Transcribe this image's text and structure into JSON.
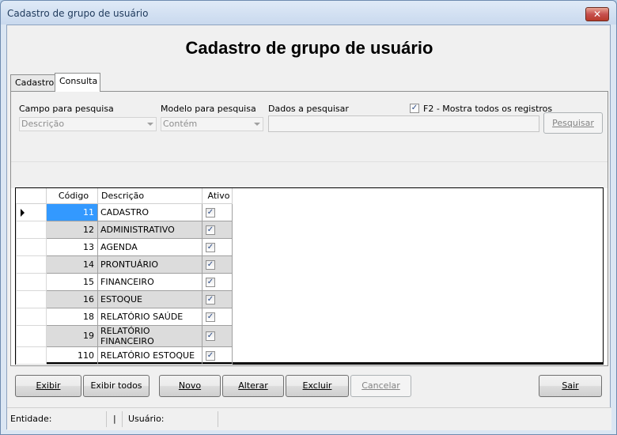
{
  "window": {
    "title": "Cadastro de grupo de usuário",
    "close_label": "✕"
  },
  "header": {
    "title": "Cadastro de grupo de usuário"
  },
  "tabs": [
    {
      "label": "Cadastro",
      "active": false
    },
    {
      "label": "Consulta",
      "active": true
    }
  ],
  "filters": {
    "campo_label": "Campo para pesquisa",
    "campo_value": "Descrição",
    "modelo_label": "Modelo para pesquisa",
    "modelo_value": "Contém",
    "dados_label": "Dados a pesquisar",
    "dados_value": "",
    "mostra_todos_label": "F2 - Mostra todos os registros",
    "mostra_todos_checked": true,
    "pesquisar_label": "Pesquisar"
  },
  "grid": {
    "columns": [
      "Código",
      "Descrição",
      "Ativo"
    ],
    "rows": [
      {
        "codigo": "11",
        "descricao": "CADASTRO",
        "ativo": true
      },
      {
        "codigo": "12",
        "descricao": "ADMINISTRATIVO",
        "ativo": true
      },
      {
        "codigo": "13",
        "descricao": "AGENDA",
        "ativo": true
      },
      {
        "codigo": "14",
        "descricao": "PRONTUÁRIO",
        "ativo": true
      },
      {
        "codigo": "15",
        "descricao": "FINANCEIRO",
        "ativo": true
      },
      {
        "codigo": "16",
        "descricao": "ESTOQUE",
        "ativo": true
      },
      {
        "codigo": "18",
        "descricao": "RELATÓRIO SAÚDE",
        "ativo": true
      },
      {
        "codigo": "19",
        "descricao": "RELATÓRIO FINANCEIRO",
        "ativo": true
      },
      {
        "codigo": "110",
        "descricao": "RELATÓRIO ESTOQUE",
        "ativo": true
      }
    ],
    "check_glyph": "✓"
  },
  "buttons": {
    "exibir": "Exibir",
    "exibir_todos": "Exibir todos",
    "novo": "Novo",
    "alterar": "Alterar",
    "excluir": "Excluir",
    "cancelar": "Cancelar",
    "sair": "Sair"
  },
  "status": {
    "entidade_label": "Entidade:",
    "divider": "|",
    "usuario_label": "Usuário:"
  }
}
